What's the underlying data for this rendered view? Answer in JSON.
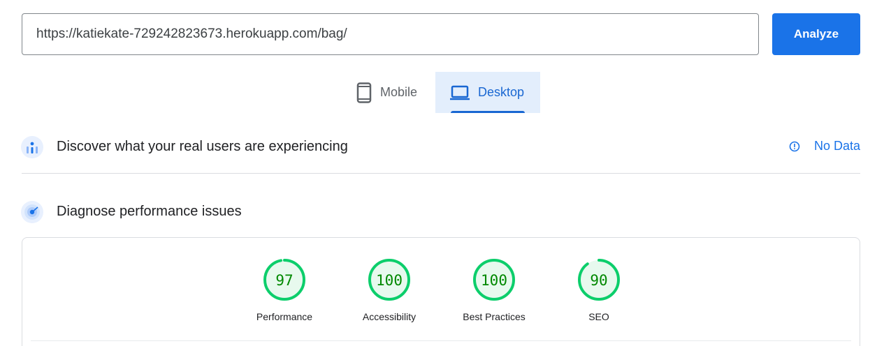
{
  "url_input": {
    "value": "https://katiekate-729242823673.herokuapp.com/bag/"
  },
  "analyze_button": {
    "label": "Analyze"
  },
  "tabs": [
    {
      "label": "Mobile",
      "icon": "phone-icon",
      "selected": false
    },
    {
      "label": "Desktop",
      "icon": "laptop-icon",
      "selected": true
    }
  ],
  "real_users": {
    "title": "Discover what your real users are experiencing",
    "icon": "crux-chart-icon",
    "status": {
      "label": "No Data",
      "icon": "info-icon"
    }
  },
  "diagnose": {
    "title": "Diagnose performance issues",
    "icon": "lighthouse-target-icon"
  },
  "scores": [
    {
      "label": "Performance",
      "value": "97",
      "fraction": 0.97
    },
    {
      "label": "Accessibility",
      "value": "100",
      "fraction": 1.0
    },
    {
      "label": "Best Practices",
      "value": "100",
      "fraction": 1.0
    },
    {
      "label": "SEO",
      "value": "90",
      "fraction": 0.9
    }
  ],
  "colors": {
    "accent": "#1a73e8",
    "pass_ring": "#0cce6b",
    "pass_fill": "#e7f9ee",
    "pass_text": "#008800",
    "tab_selected_bg": "#e3eefc"
  }
}
